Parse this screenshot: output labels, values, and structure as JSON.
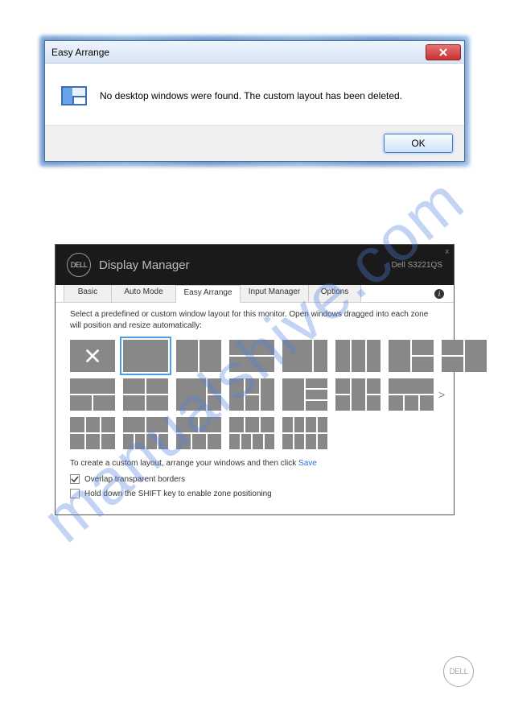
{
  "watermark": "manualshive.com",
  "dialog1": {
    "title": "Easy Arrange",
    "message": "No desktop windows were found.  The custom layout has been deleted.",
    "ok_label": "OK",
    "close_label": "X"
  },
  "dialog2": {
    "logo_text": "DELL",
    "app_title": "Display Manager",
    "monitor_name": "Dell S3221QS",
    "close_label": "x",
    "tabs": {
      "basic": "Basic",
      "auto_mode": "Auto Mode",
      "easy_arrange": "Easy Arrange",
      "input_manager": "Input Manager",
      "options": "Options"
    },
    "info_label": "i",
    "instructions": "Select a predefined or custom window layout for this monitor.  Open windows dragged into each zone will position and resize automatically:",
    "create_text": "To create a custom layout, arrange your windows and then click ",
    "save_link": "Save",
    "overlap_label": "Overlap transparent borders",
    "shift_label": "Hold down the SHIFT key to enable zone positioning",
    "arrow_next": ">"
  },
  "footer": {
    "logo_text": "DELL"
  }
}
